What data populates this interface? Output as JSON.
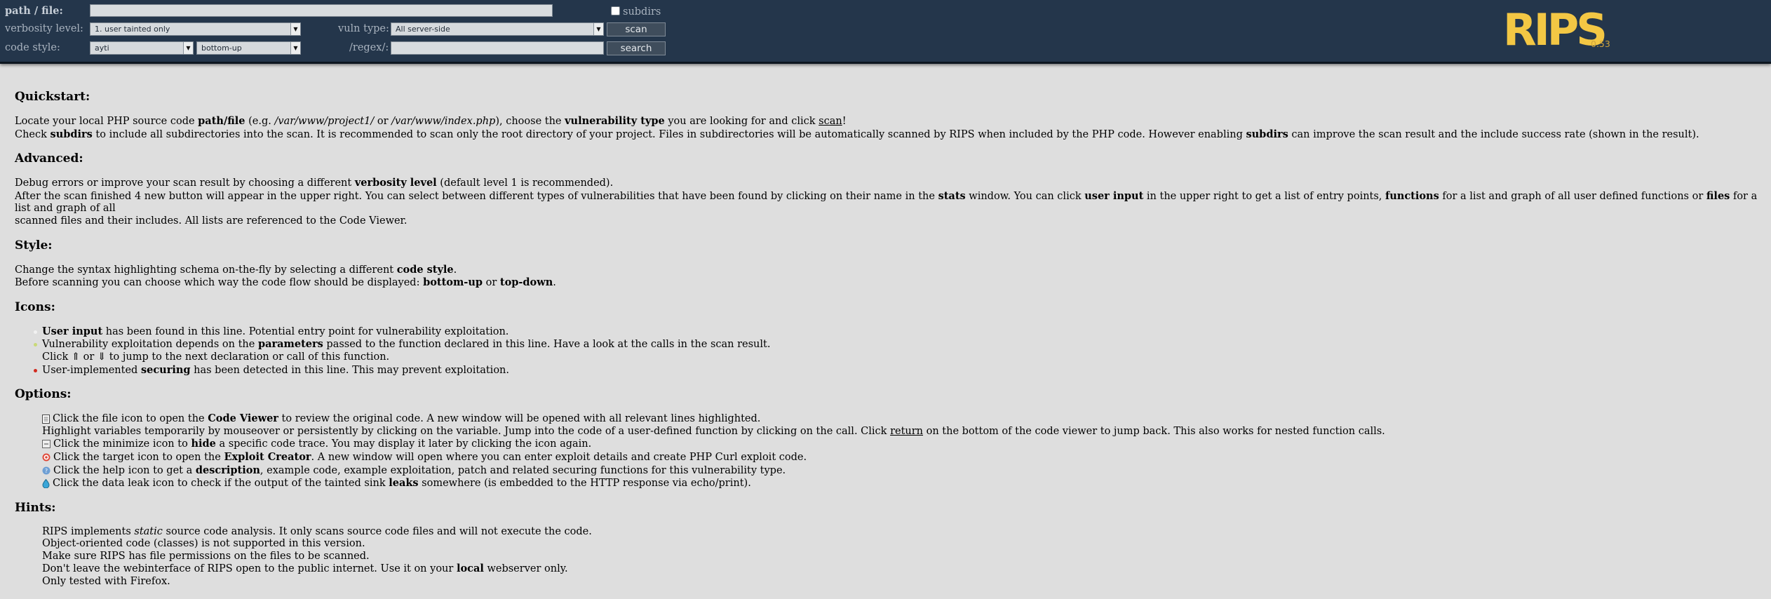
{
  "header": {
    "path_label": "path / file:",
    "path_value": "",
    "subdirs_label": "subdirs",
    "verbosity_label": "verbosity level:",
    "verbosity_value": "1. user tainted only",
    "vuln_label": "vuln type:",
    "vuln_value": "All server-side",
    "scan_label": "scan",
    "code_style_label": "code style:",
    "code_style_value": "ayti",
    "flow_value": "bottom-up",
    "regex_label": "/regex/:",
    "regex_value": "",
    "search_label": "search",
    "logo": "RIPS",
    "version": "0.53",
    "colors": {
      "bar": "#24364b",
      "logo": "#f3c744",
      "version": "#cfa43c"
    }
  },
  "quickstart": {
    "title": "Quickstart:",
    "l1a": "Locate your local PHP source code ",
    "l1b": "path/file",
    "l1c": " (e.g. ",
    "l1d": "/var/www/project1/",
    "l1e": " or ",
    "l1f": "/var/www/index.php",
    "l1g": "), choose the ",
    "l1h": "vulnerability type",
    "l1i": " you are looking for and click ",
    "l1j": "scan",
    "l1k": "!",
    "l2a": "Check ",
    "l2b": "subdirs",
    "l2c": " to include all subdirectories into the scan. It is recommended to scan only the root directory of your project. Files in subdirectories will be automatically scanned by RIPS when included by the PHP code. However enabling ",
    "l2d": "subdirs",
    "l2e": " can improve the scan result and the include success rate (shown in the result)."
  },
  "advanced": {
    "title": "Advanced:",
    "l1a": "Debug errors or improve your scan result by choosing a different ",
    "l1b": "verbosity level",
    "l1c": " (default level 1 is recommended).",
    "l2a": "After the scan finished 4 new button will appear in the upper right. You can select between different types of vulnerabilities that have been found by clicking on their name in the ",
    "l2b": "stats",
    "l2c": " window. You can click ",
    "l2d": "user input",
    "l2e": " in the upper right to get a list of entry points, ",
    "l2f": "functions",
    "l2g": " for a list and graph of all user defined functions or ",
    "l2h": "files",
    "l2i": " for a list and graph of all",
    "l3": "scanned files and their includes. All lists are referenced to the Code Viewer."
  },
  "style": {
    "title": "Style:",
    "l1a": "Change the syntax highlighting schema on-the-fly by selecting a different ",
    "l1b": "code style",
    "l1c": ".",
    "l2a": "Before scanning you can choose which way the code flow should be displayed: ",
    "l2b": "bottom-up",
    "l2c": " or ",
    "l2d": "top-down",
    "l2e": "."
  },
  "icons": {
    "title": "Icons:",
    "i1a": "User input",
    "i1b": " has been found in this line. Potential entry point for vulnerability exploitation.",
    "i2a": "Vulnerability exploitation depends on the ",
    "i2b": "parameters",
    "i2c": " passed to the function declared in this line. Have a look at the calls in the scan result.",
    "i3a": "Click ",
    "i3b": "⇑",
    "i3c": " or ",
    "i3d": "⇓",
    "i3e": " to jump to the next declaration or call of this function.",
    "i4a": "User-implemented ",
    "i4b": "securing",
    "i4c": " has been detected in this line. This may prevent exploitation."
  },
  "options": {
    "title": "Options:",
    "o1a": "Click the file icon to open the ",
    "o1b": "Code Viewer",
    "o1c": " to review the original code. A new window will be opened with all relevant lines highlighted.",
    "o2a": "Highlight variables temporarily by mouseover or persistently by clicking on the variable. Jump into the code of a user-defined function by clicking on the call. Click ",
    "o2b": "return",
    "o2c": " on the bottom of the code viewer to jump back. This also works for nested function calls.",
    "o3a": "Click the minimize icon to ",
    "o3b": "hide",
    "o3c": " a specific code trace. You may display it later by clicking the icon again.",
    "o4a": "Click the target icon to open the ",
    "o4b": "Exploit Creator",
    "o4c": ". A new window will open where you can enter exploit details and create PHP Curl exploit code.",
    "o5a": "Click the help icon to get a ",
    "o5b": "description",
    "o5c": ", example code, example exploitation, patch and related securing functions for this vulnerability type.",
    "o6a": "Click the data leak icon to check if the output of the tainted sink ",
    "o6b": "leaks",
    "o6c": " somewhere (is embedded to the HTTP response via echo/print)."
  },
  "hints": {
    "title": "Hints:",
    "h1a": "RIPS implements ",
    "h1b": "static",
    "h1c": " source code analysis. It only scans source code files and will not execute the code.",
    "h2": "Object-oriented code (classes) is not supported in this version.",
    "h3": "Make sure RIPS has file permissions on the files to be scanned.",
    "h4a": "Don't leave the webinterface of RIPS open to the public internet. Use it on your ",
    "h4b": "local",
    "h4c": " webserver only.",
    "h5": "Only tested with Firefox."
  }
}
